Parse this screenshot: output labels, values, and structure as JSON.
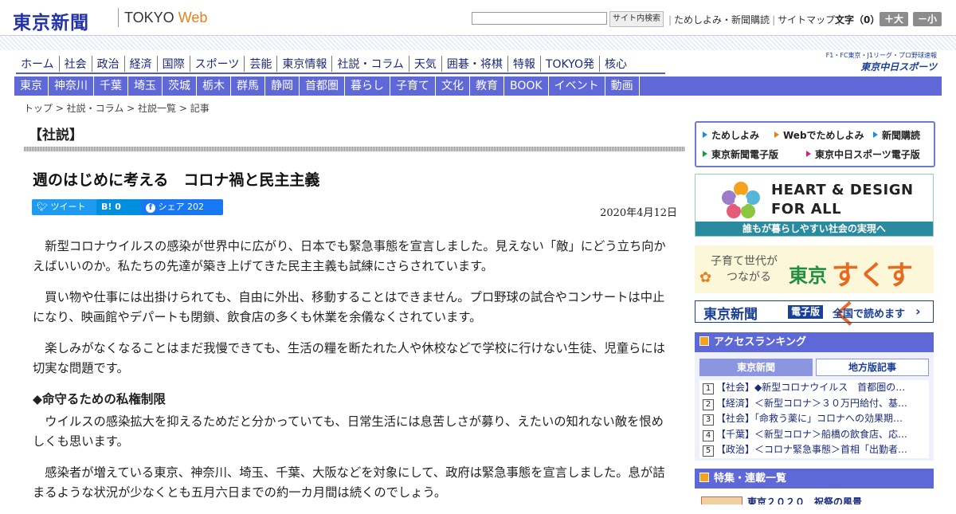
{
  "header": {
    "logo": "東京新聞",
    "logo_sub": "TOKYO",
    "logo_web": "Web",
    "search_placeholder": "",
    "search_button": "サイト内検索",
    "links": [
      "ためしよみ・新聞購読",
      "サイトマップ"
    ],
    "font_size_label": "文字（0）",
    "font_bigger": "＋大",
    "font_smaller": "－小"
  },
  "nav_main": [
    "ホーム",
    "社会",
    "政治",
    "経済",
    "国際",
    "スポーツ",
    "芸能",
    "東京情報",
    "社説・コラム",
    "天気",
    "囲碁・将棋",
    "特報",
    "TOKYO発",
    "核心"
  ],
  "sports_logo": {
    "line1": "F1・FC東京・J1リーグ・プロ野球速報",
    "line2": "東京中日スポーツ"
  },
  "nav_region": [
    "東京",
    "神奈川",
    "千葉",
    "埼玉",
    "茨城",
    "栃木",
    "群馬",
    "静岡",
    "首都圏",
    "暮らし",
    "子育て",
    "文化",
    "教育",
    "BOOK",
    "イベント",
    "動画"
  ],
  "breadcrumb": "トップ > 社説・コラム > 社説一覧 > 記事",
  "article": {
    "section": "【社説】",
    "title": "週のはじめに考える　コロナ禍と民主主義",
    "tweet": "ツイート",
    "hatena": "B! 0",
    "facebook": "シェア 202",
    "date": "2020年4月12日",
    "paragraphs": [
      "新型コロナウイルスの感染が世界中に広がり、日本でも緊急事態を宣言しました。見えない「敵」にどう立ち向かえばいいのか。私たちの先達が築き上げてきた民主主義も試練にさらされています。",
      "買い物や仕事には出掛けられても、自由に外出、移動することはできません。プロ野球の試合やコンサートは中止になり、映画館やデパートも閉鎖、飲食店の多くも休業を余儀なくされています。",
      "楽しみがなくなることはまだ我慢できても、生活の糧を断たれた人や休校などで学校に行けない生徒、児童らには切実な問題です。"
    ],
    "subheading": "◆命守るための私権制限",
    "paragraphs2": [
      "ウイルスの感染拡大を抑えるためだと分かっていても、日常生活には息苦しさが募り、えたいの知れない敵を恨めしくも思います。",
      "感染者が増えている東京、神奈川、埼玉、千葉、大阪などを対象にして、政府は緊急事態を宣言しました。息が詰まるような状況が少なくとも五月六日までの約一カ月間は続くのでしょう。"
    ]
  },
  "sidebar": {
    "links": [
      "ためしよみ",
      "Webでためしよみ",
      "新聞購読",
      "東京新聞電子版",
      "東京中日スポーツ電子版"
    ],
    "banner1_line1": "HEART & DESIGN",
    "banner1_line2": "FOR ALL",
    "banner1_bottom": "誰もが暮らしやすい社会の実現へ",
    "banner2_line1": "子育て世代が",
    "banner2_line2": "つながる",
    "banner2_tokyo": "東京",
    "banner2_main": "すくすく",
    "banner3_logo": "東京新聞",
    "banner3_tag": "電子版",
    "banner3_text": "全国で読めます",
    "ranking_title": "アクセスランキング",
    "ranking_tabs": [
      "東京新聞",
      "地方版記事"
    ],
    "ranking": [
      "【社会】◆新型コロナウイルス　首都圏の…",
      "【経済】＜新型コロナ＞３０万円給付、基…",
      "【社会】「命救う薬に」コロナへの効果期…",
      "【千葉】＜新型コロナ＞船橋の飲食店、応…",
      "【政治】＜コロナ緊急事態＞首相「出勤者…"
    ],
    "feature_title": "特集・連載一覧",
    "feature_peek": "東京２０２０　祝祭の風景"
  },
  "colors": {
    "nav_blue": "#5f68d7",
    "logo_blue": "#2233a8",
    "web_orange": "#e8801a"
  }
}
